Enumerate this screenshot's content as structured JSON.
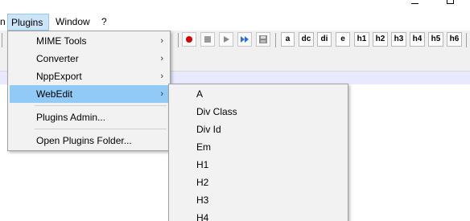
{
  "menubar": {
    "partial_left": "n",
    "plugins": "Plugins",
    "window": "Window",
    "help": "?"
  },
  "toolbar": {
    "tags": [
      "a",
      "dc",
      "di",
      "e",
      "h1",
      "h2",
      "h3",
      "h4",
      "h5",
      "h6"
    ]
  },
  "plugins_menu": {
    "items": [
      {
        "label": "MIME Tools",
        "submenu": true
      },
      {
        "label": "Converter",
        "submenu": true
      },
      {
        "label": "NppExport",
        "submenu": true
      },
      {
        "label": "WebEdit",
        "submenu": true,
        "selected": true
      },
      {
        "label": "Plugins Admin..."
      },
      {
        "label": "Open Plugins Folder..."
      }
    ],
    "arrow": "›"
  },
  "webedit_submenu": {
    "items": [
      "A",
      "Div Class",
      "Div Id",
      "Em",
      "H1",
      "H2",
      "H3",
      "H4"
    ]
  },
  "colors": {
    "selected_bg": "#91c9f7",
    "menu_open_bg": "#cce4f7",
    "record_red": "#d10000",
    "play_blue": "#2e6fd8"
  }
}
